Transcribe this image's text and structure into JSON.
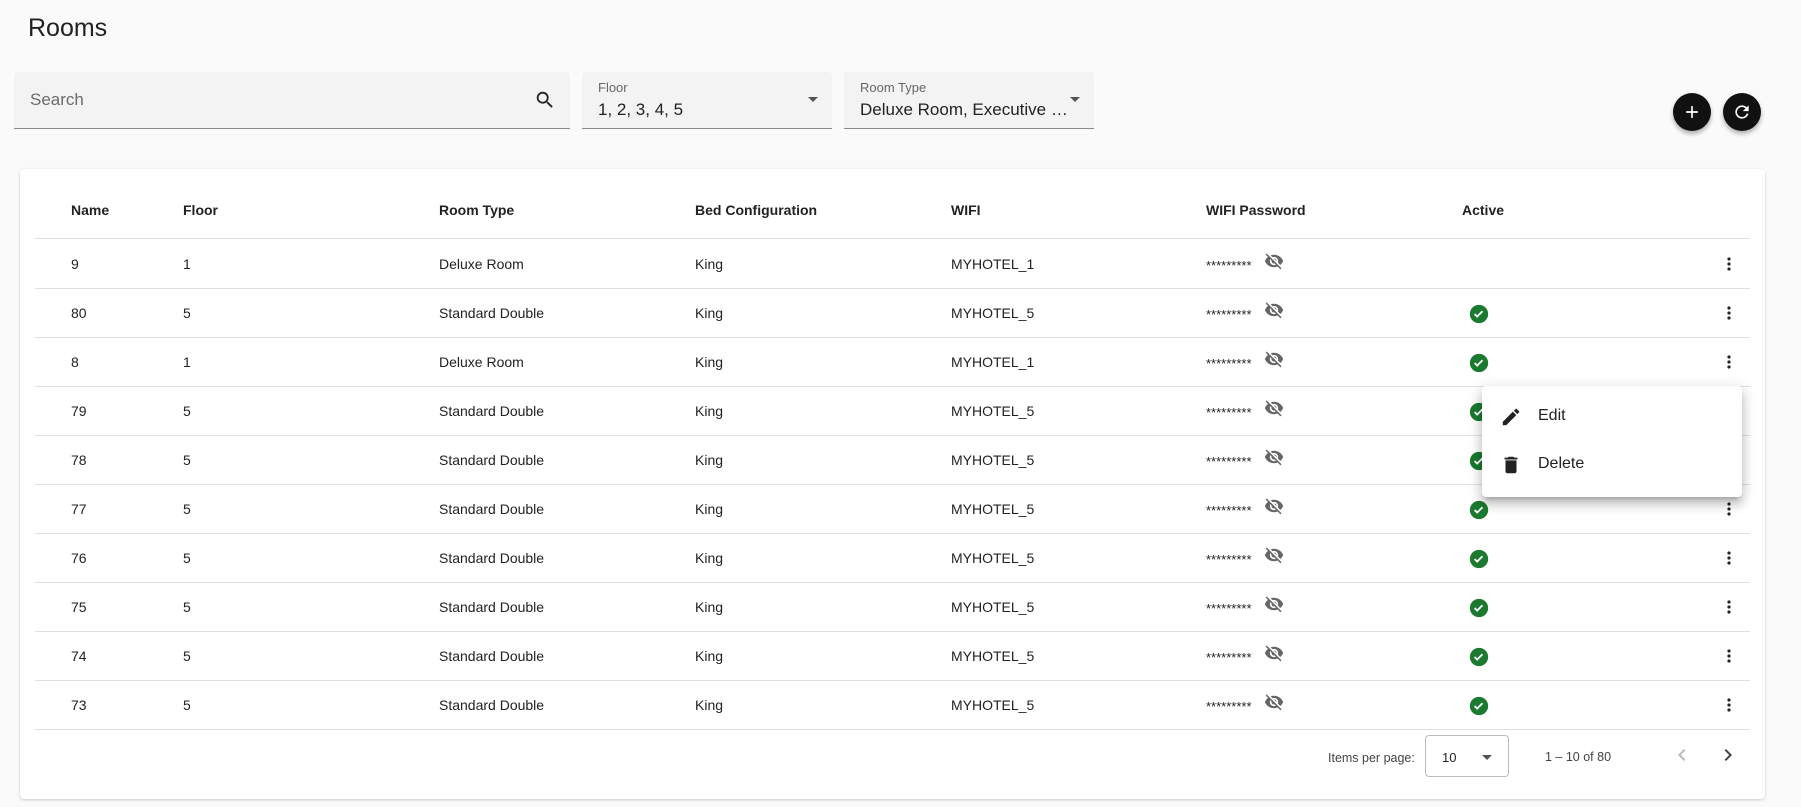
{
  "page": {
    "title": "Rooms"
  },
  "filters": {
    "search": {
      "placeholder": "Search",
      "value": ""
    },
    "floor": {
      "label": "Floor",
      "value": "1, 2, 3, 4, 5"
    },
    "room_type": {
      "label": "Room Type",
      "value": "Deluxe Room, Executive S…"
    }
  },
  "actions": {
    "add_icon": "plus-icon",
    "refresh_icon": "refresh-icon"
  },
  "table": {
    "columns": [
      "Name",
      "Floor",
      "Room Type",
      "Bed Configuration",
      "WIFI",
      "WIFI Password",
      "Active"
    ],
    "rows": [
      {
        "name": "9",
        "floor": "1",
        "room_type": "Deluxe Room",
        "bed": "King",
        "wifi": "MYHOTEL_1",
        "password": "*********",
        "active": false
      },
      {
        "name": "80",
        "floor": "5",
        "room_type": "Standard Double",
        "bed": "King",
        "wifi": "MYHOTEL_5",
        "password": "*********",
        "active": true
      },
      {
        "name": "8",
        "floor": "1",
        "room_type": "Deluxe Room",
        "bed": "King",
        "wifi": "MYHOTEL_1",
        "password": "*********",
        "active": true
      },
      {
        "name": "79",
        "floor": "5",
        "room_type": "Standard Double",
        "bed": "King",
        "wifi": "MYHOTEL_5",
        "password": "*********",
        "active": true
      },
      {
        "name": "78",
        "floor": "5",
        "room_type": "Standard Double",
        "bed": "King",
        "wifi": "MYHOTEL_5",
        "password": "*********",
        "active": true
      },
      {
        "name": "77",
        "floor": "5",
        "room_type": "Standard Double",
        "bed": "King",
        "wifi": "MYHOTEL_5",
        "password": "*********",
        "active": true
      },
      {
        "name": "76",
        "floor": "5",
        "room_type": "Standard Double",
        "bed": "King",
        "wifi": "MYHOTEL_5",
        "password": "*********",
        "active": true
      },
      {
        "name": "75",
        "floor": "5",
        "room_type": "Standard Double",
        "bed": "King",
        "wifi": "MYHOTEL_5",
        "password": "*********",
        "active": true
      },
      {
        "name": "74",
        "floor": "5",
        "room_type": "Standard Double",
        "bed": "King",
        "wifi": "MYHOTEL_5",
        "password": "*********",
        "active": true
      },
      {
        "name": "73",
        "floor": "5",
        "room_type": "Standard Double",
        "bed": "King",
        "wifi": "MYHOTEL_5",
        "password": "*********",
        "active": true
      }
    ]
  },
  "paginator": {
    "items_per_page_label": "Items per page:",
    "items_per_page_value": "10",
    "range_label": "1 – 10 of 80"
  },
  "context_menu": {
    "items": [
      {
        "label": "Edit",
        "icon": "pencil-icon"
      },
      {
        "label": "Delete",
        "icon": "trash-icon"
      }
    ]
  },
  "colors": {
    "active_green": "#1b7a2f",
    "fab_background": "#111111"
  }
}
